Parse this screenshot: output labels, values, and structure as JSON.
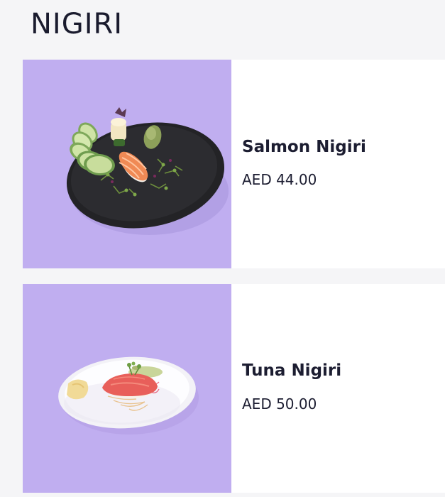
{
  "section": {
    "title": "NIGIRI"
  },
  "items": [
    {
      "name": "Salmon Nigiri",
      "price": "AED 44.00",
      "image": "salmon-nigiri-plate-image"
    },
    {
      "name": "Tuna Nigiri",
      "price": "AED 50.00",
      "image": "tuna-nigiri-plate-image"
    }
  ],
  "colors": {
    "page_background": "#f5f5f7",
    "card_background": "#ffffff",
    "image_background": "#c0aef0",
    "text": "#1c1d31"
  }
}
